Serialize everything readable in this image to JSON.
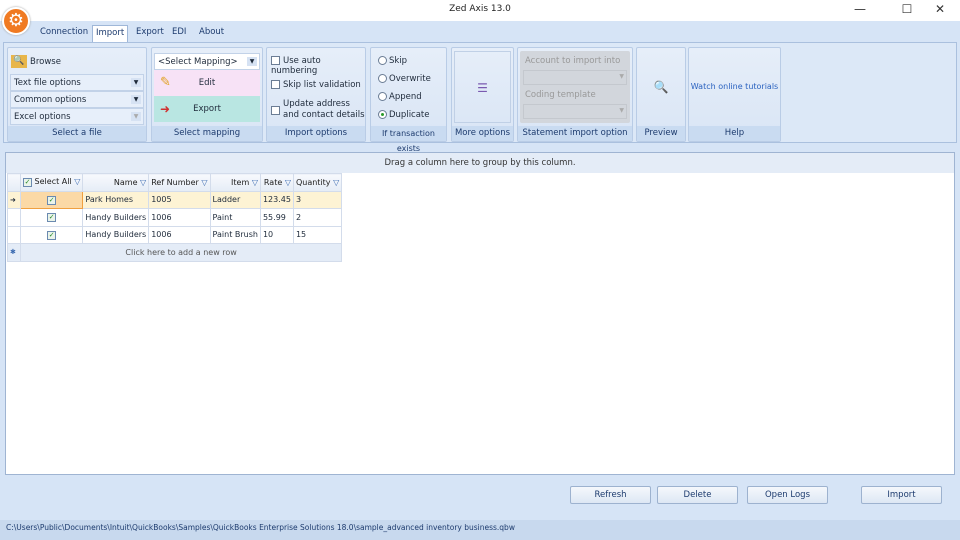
{
  "window": {
    "title": "Zed Axis 13.0",
    "minimize": "—",
    "maximize": "☐",
    "close": "✕"
  },
  "tabs": [
    {
      "label": "Connection"
    },
    {
      "label": "Import"
    },
    {
      "label": "Export"
    },
    {
      "label": "EDI"
    },
    {
      "label": "About"
    }
  ],
  "ribbon": {
    "select_file": {
      "browse": "Browse",
      "text_file_options": "Text file options",
      "common_options": "Common options",
      "excel_options": "Excel options",
      "label": "Select a file"
    },
    "select_mapping": {
      "dropdown": "<Select Mapping>",
      "edit": "Edit",
      "export": "Export",
      "label": "Select mapping"
    },
    "import_options": {
      "auto_numbering": "Use auto numbering",
      "skip_list": "Skip list validation",
      "update_address": "Update address and contact details",
      "label": "Import options"
    },
    "transaction_exists": {
      "options": [
        "Skip",
        "Overwrite",
        "Append",
        "Duplicate"
      ],
      "selected": "Duplicate",
      "label": "If transaction exists"
    },
    "more_options": {
      "label": "More options"
    },
    "statement": {
      "account": "Account to import into",
      "coding": "Coding template",
      "label": "Statement import option"
    },
    "preview": {
      "label": "Preview"
    },
    "help": {
      "link": "Watch online tutorials",
      "label": "Help"
    }
  },
  "grid": {
    "group_hint": "Drag a column here to group by this column.",
    "columns": [
      "Select All",
      "Name",
      "Ref Number",
      "Item",
      "Rate",
      "Quantity"
    ],
    "rows": [
      {
        "checked": true,
        "name": "Park Homes",
        "ref": "1005",
        "item": "Ladder",
        "rate": "123.45",
        "qty": "3"
      },
      {
        "checked": true,
        "name": "Handy Builders",
        "ref": "1006",
        "item": "Paint",
        "rate": "55.99",
        "qty": "2"
      },
      {
        "checked": true,
        "name": "Handy Builders",
        "ref": "1006",
        "item": "Paint Brush",
        "rate": "10",
        "qty": "15"
      }
    ],
    "new_row": "Click here to add a new row"
  },
  "buttons": {
    "refresh": "Refresh",
    "delete": "Delete",
    "open_logs": "Open Logs",
    "import": "Import"
  },
  "status": {
    "path": "C:\\Users\\Public\\Documents\\Intuit\\QuickBooks\\Samples\\QuickBooks Enterprise Solutions 18.0\\sample_advanced inventory business.qbw"
  }
}
